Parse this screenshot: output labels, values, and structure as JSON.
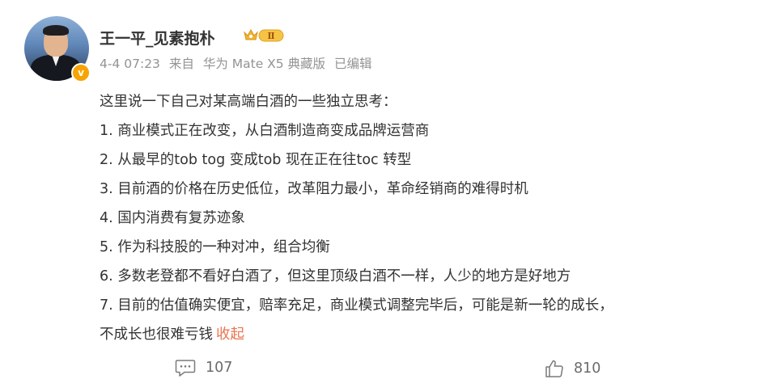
{
  "user": {
    "name": "王一平_见素抱朴",
    "vip_badge": "Ⅱ"
  },
  "meta": {
    "time": "4-4 07:23",
    "source_prefix": "来自",
    "source_device": "华为 Mate X5 典藏版",
    "edited": "已编辑"
  },
  "post": {
    "lines": [
      "这里说一下自己对某高端白酒的一些独立思考：",
      "1. 商业模式正在改变，从白酒制造商变成品牌运营商",
      "2. 从最早的tob tog 变成tob 现在正在往toc 转型",
      "3. 目前酒的价格在历史低位，改革阻力最小，革命经销商的难得时机",
      "4. 国内消费有复苏迹象",
      "5. 作为科技股的一种对冲，组合均衡",
      "6. 多数老登都不看好白酒了，但这里顶级白酒不一样，人少的地方是好地方",
      "7. 目前的估值确实便宜，赔率充足，商业模式调整完毕后，可能是新一轮的成长，",
      "不成长也很难亏钱"
    ],
    "collapse_label": "收起"
  },
  "actions": {
    "comments": "107",
    "likes": "810"
  },
  "colors": {
    "link": "#eb7350",
    "meta": "#939393",
    "text": "#333333",
    "vip_gold": "#f2b530",
    "verified": "#f7a400"
  }
}
